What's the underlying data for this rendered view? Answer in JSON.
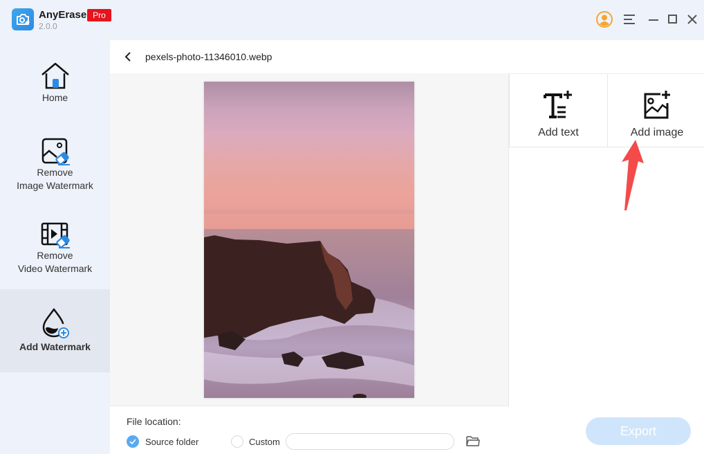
{
  "app": {
    "name": "AnyErase",
    "badge": "Pro",
    "version": "2.0.0"
  },
  "titlebar": {
    "icons": [
      "account-icon",
      "menu-icon",
      "minimize-icon",
      "maximize-icon",
      "close-icon"
    ],
    "account_color": "#f7a531"
  },
  "sidebar": {
    "items": [
      {
        "label": "Home",
        "icon": "home-icon",
        "active": false
      },
      {
        "label": "Remove\nImage Watermark",
        "line1": "Remove",
        "line2": "Image Watermark",
        "icon": "image-eraser-icon",
        "active": false
      },
      {
        "label": "Remove\nVideo Watermark",
        "line1": "Remove",
        "line2": "Video Watermark",
        "icon": "video-eraser-icon",
        "active": false
      },
      {
        "label": "Add Watermark",
        "icon": "droplet-plus-icon",
        "active": true
      }
    ]
  },
  "header": {
    "back_icon": "chevron-left-icon",
    "file_name": "pexels-photo-11346010.webp"
  },
  "tools": {
    "add_text": "Add text",
    "add_image": "Add image"
  },
  "bottom": {
    "file_location_label": "File location:",
    "options": [
      {
        "label": "Source folder",
        "checked": true
      },
      {
        "label": "Custom",
        "checked": false
      }
    ],
    "custom_path_value": "",
    "export_label": "Export"
  },
  "colors": {
    "accent": "#2b8be3",
    "pro_badge": "#e5141d",
    "export_disabled": "#cfe5fb",
    "annotation_arrow": "#f44a4a"
  }
}
